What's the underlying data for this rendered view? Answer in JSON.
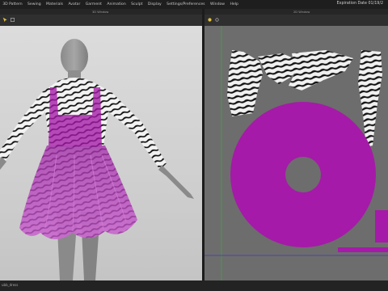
{
  "menu": {
    "items": [
      "3D Pattern",
      "Sewing",
      "Materials",
      "Avatar",
      "Garment",
      "Animation",
      "Sculpt",
      "Display",
      "Settings/Preferences",
      "Window",
      "Help"
    ],
    "expiration": "Expiration Date 01/19/2"
  },
  "panels": {
    "window3d_title": "3D Window",
    "window2d_title": "2D Window"
  },
  "status": {
    "object_name": "ubb_dress"
  },
  "colors": {
    "fabric_purple": "#a51aa8",
    "viewport_bg": "#d6d6d6",
    "pattern_bg": "#6d6d6d"
  }
}
